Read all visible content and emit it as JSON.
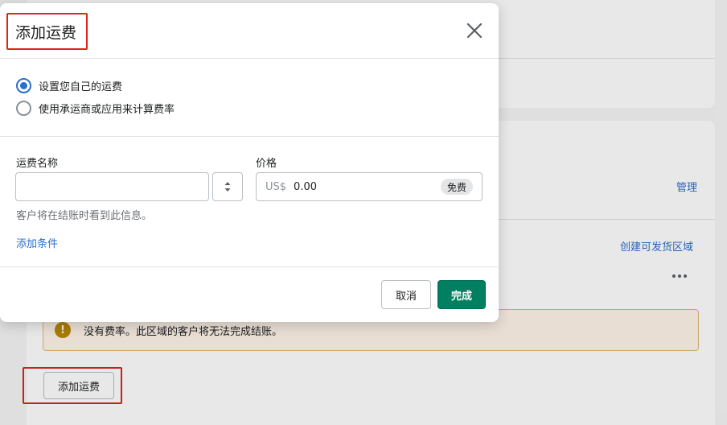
{
  "modal": {
    "title": "添加运费",
    "rate_options": [
      {
        "label": "设置您自己的运费",
        "checked": true
      },
      {
        "label": "使用承运商或应用来计算费率",
        "checked": false
      }
    ],
    "rate_name": {
      "label": "运费名称",
      "value": "",
      "help_text": "客户将在结账时看到此信息。"
    },
    "price": {
      "label": "价格",
      "currency": "US$",
      "value": "0.00",
      "badge": "免费"
    },
    "add_condition_label": "添加条件",
    "cancel_label": "取消",
    "done_label": "完成"
  },
  "background": {
    "manage_link": "管理",
    "create_zone_link": "创建可发货区域",
    "warning_text": "没有费率。此区域的客户将无法完成结账。",
    "add_rate_button": "添加运费"
  },
  "icons": {
    "close": "close-icon",
    "stepper": "select-arrows-icon",
    "more": "more-horizontal-icon",
    "warning": "alert-icon"
  },
  "colors": {
    "primary_button": "#008060",
    "link": "#2c6ecb",
    "highlight_box": "#e0241b",
    "warning_bg": "#fff5ea",
    "warning_icon": "#b98900"
  }
}
